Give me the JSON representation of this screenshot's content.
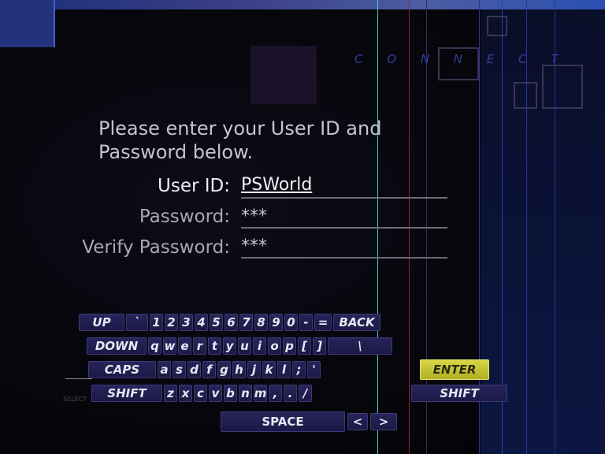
{
  "header": {
    "connect_label": "C O N N E C T"
  },
  "instructions": {
    "line1": "Please enter your User ID and",
    "line2": "Password below."
  },
  "form": {
    "user_id": {
      "label": "User ID:",
      "value": "PSWorld"
    },
    "password": {
      "label": "Password:",
      "value": "***"
    },
    "verify_password": {
      "label": "Verify Password:",
      "value": "***"
    }
  },
  "keyboard": {
    "row1": [
      "UP",
      "`",
      "1",
      "2",
      "3",
      "4",
      "5",
      "6",
      "7",
      "8",
      "9",
      "0",
      "-",
      "=",
      "BACK"
    ],
    "row2": [
      "DOWN",
      "q",
      "w",
      "e",
      "r",
      "t",
      "y",
      "u",
      "i",
      "o",
      "p",
      "[",
      "]",
      "\\"
    ],
    "row3": [
      "CAPS",
      "a",
      "s",
      "d",
      "f",
      "g",
      "h",
      "j",
      "k",
      "l",
      ";",
      "'",
      "ENTER"
    ],
    "row4": [
      "SHIFT",
      "z",
      "x",
      "c",
      "v",
      "b",
      "n",
      "m",
      ",",
      ".",
      "/",
      "SHIFT"
    ],
    "row5": [
      "SPACE",
      "<",
      ">"
    ]
  },
  "footer": {
    "select_hint": "SELECT"
  },
  "colors": {
    "accent_enter": "#d8d645",
    "key_bg": "#1b1946",
    "text_primary": "#e8e6f2",
    "text_dim": "#a9a6b8"
  }
}
